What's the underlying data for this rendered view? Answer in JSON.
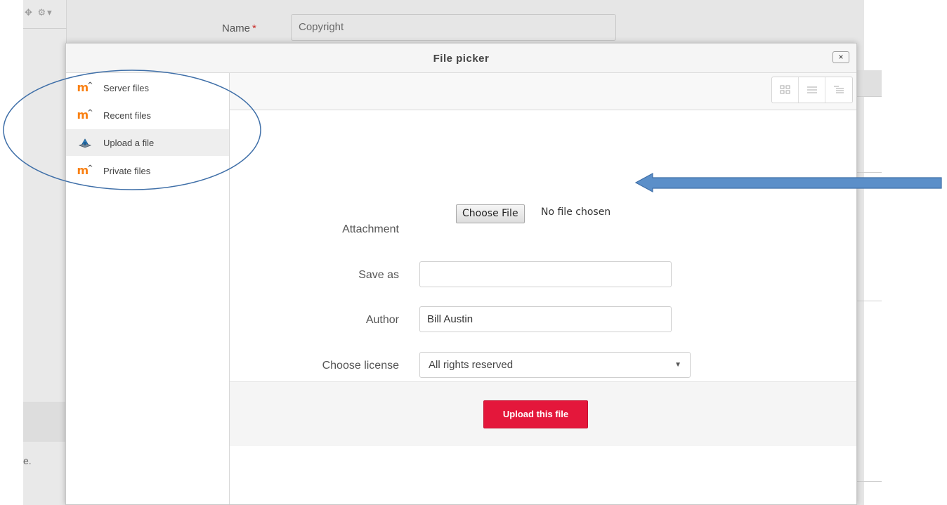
{
  "background": {
    "name_label": "Name",
    "required_mark": "*",
    "name_value": "Copyright",
    "toolbar_icons": "✥ ⚙▾",
    "partial_text": "e."
  },
  "dialog": {
    "title": "File picker",
    "close_symbol": "×",
    "sidebar": {
      "items": [
        {
          "label": "Server files",
          "icon": "moodle-logo-icon"
        },
        {
          "label": "Recent files",
          "icon": "moodle-logo-icon"
        },
        {
          "label": "Upload a file",
          "icon": "upload-icon",
          "active": true
        },
        {
          "label": "Private files",
          "icon": "moodle-logo-icon"
        }
      ]
    },
    "view_modes": [
      "icons-view-icon",
      "list-view-icon",
      "tree-view-icon"
    ],
    "form": {
      "attachment_label": "Attachment",
      "choose_file_button": "Choose File",
      "file_status": "No file chosen",
      "save_as_label": "Save as",
      "save_as_value": "",
      "author_label": "Author",
      "author_value": "Bill Austin",
      "license_label": "Choose license",
      "license_selected": "All rights reserved"
    },
    "upload_button": "Upload this file"
  },
  "colors": {
    "accent_button": "#e4173b",
    "moodle_orange": "#f98012",
    "annotation_blue": "#3f6fa8",
    "arrow_fill": "#5b8fc9"
  }
}
